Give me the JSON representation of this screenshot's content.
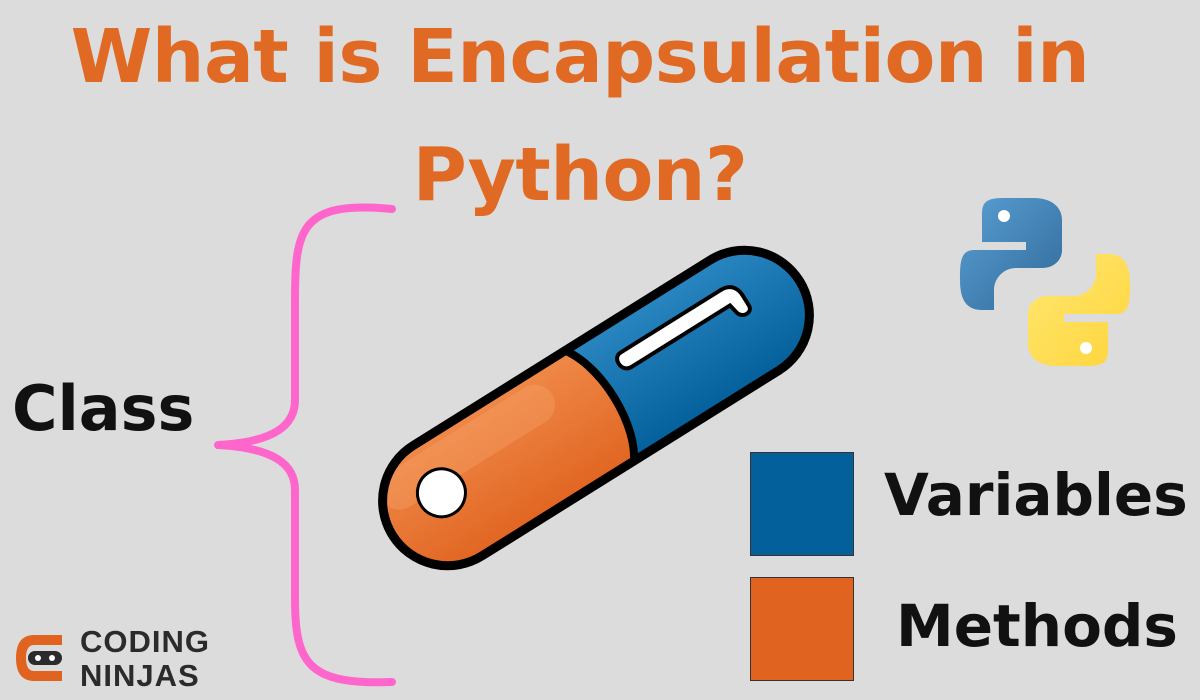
{
  "title": {
    "line1": "What is Encapsulation in",
    "line2": "Python?"
  },
  "class_label": "Class",
  "legend": [
    {
      "label": "Variables",
      "color": "#04609a"
    },
    {
      "label": "Methods",
      "color": "#e06420"
    }
  ],
  "brand": {
    "line1": "CODING",
    "line2": "NINJAS",
    "color": "#e06420"
  },
  "colors": {
    "background": "#dcdcdc",
    "title": "#e06a24",
    "brace": "#ff66cc",
    "capsule_blue": "#04609a",
    "capsule_orange": "#e06420",
    "python_blue": "#3a73a8",
    "python_yellow": "#ffd43b"
  },
  "icons": [
    "capsule-icon",
    "python-logo-icon",
    "coding-ninjas-logo-icon",
    "curly-brace"
  ]
}
